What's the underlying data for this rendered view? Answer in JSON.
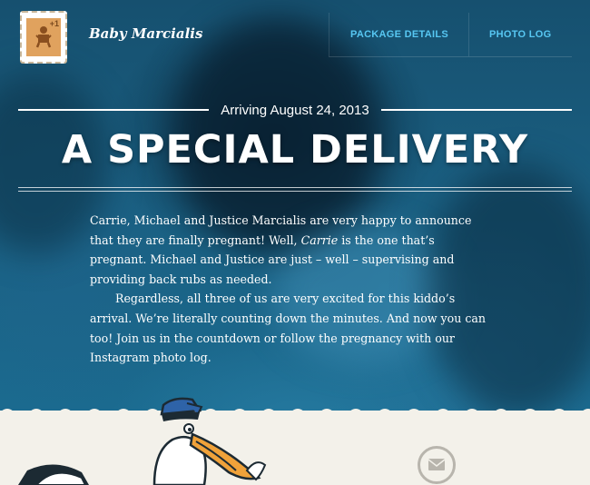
{
  "header": {
    "brand": "Baby Marcialis",
    "logo_badge": "+1",
    "nav": [
      {
        "label": "PACKAGE DETAILS"
      },
      {
        "label": "PHOTO LOG"
      }
    ]
  },
  "hero": {
    "arriving": "Arriving August 24, 2013",
    "title": "A SPECIAL DELIVERY",
    "p1_a": "Carrie, Michael and Justice Marcialis are very happy to announce that they are finally pregnant! Well, ",
    "p1_em": "Carrie",
    "p1_b": " is the one that’s pregnant. Michael and Justice are just – well – supervising and providing back rubs as needed.",
    "p2": "Regardless, all three of us are very excited for this kiddo’s arrival. We’re literally counting down the minutes. And now you can too! Join us in the countdown or follow the pregnancy with our Instagram photo log."
  },
  "colors": {
    "nav_link": "#57c7f2",
    "hero_blue": "#1a5e80",
    "paper": "#f3f1ea"
  },
  "icons": [
    "baby-stamp-logo-icon",
    "mail-icon",
    "stork-mascot-icon"
  ]
}
